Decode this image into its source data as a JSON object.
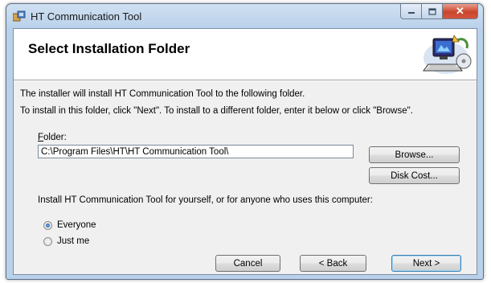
{
  "window": {
    "title": "HT Communication Tool",
    "close_glyph": "✕",
    "icons": [
      "installer-app-icon",
      "minimize-icon",
      "maximize-icon",
      "close-icon"
    ]
  },
  "banner": {
    "title": "Select Installation Folder",
    "graphic_icon": "computer-installer-icon"
  },
  "body": {
    "line1": "The installer will install HT Communication Tool to the following folder.",
    "line2": "To install in this folder, click \"Next\". To install to a different folder, enter it below or click \"Browse\"."
  },
  "folder": {
    "label_mnemonic": "F",
    "label_rest": "older:",
    "value": "C:\\Program Files\\HT\\HT Communication Tool\\"
  },
  "buttons": {
    "browse": "Browse...",
    "disk_cost": "Disk Cost...",
    "cancel": "Cancel",
    "back": "< Back",
    "next": "Next >"
  },
  "install_for": {
    "label": "Install HT Communication Tool for yourself, or for anyone who uses this computer:",
    "options": [
      {
        "label": "Everyone",
        "selected": true
      },
      {
        "label": "Just me",
        "selected": false
      }
    ]
  },
  "colors": {
    "title_bar": "#bcd3ea",
    "close_button": "#c9452c",
    "dialog_background": "#f0f0f0",
    "banner_background": "#ffffff",
    "default_button_border": "#3c7fb1"
  }
}
